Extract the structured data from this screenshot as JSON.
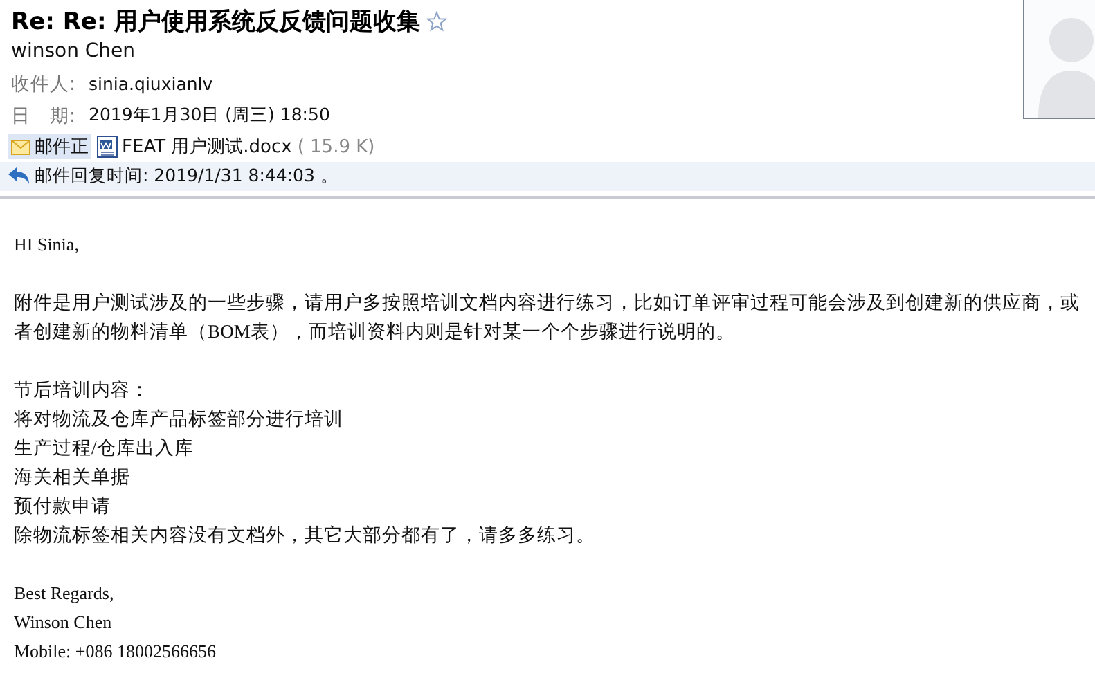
{
  "header": {
    "subject": "Re: Re: 用户使用系统反反馈问题收集",
    "starred": false,
    "sender": "winson Chen",
    "fields": [
      {
        "label": "收件人:",
        "value": "sinia.qiuxianlv"
      },
      {
        "label": "日　期:",
        "value": "2019年1月30日 (周三) 18:50"
      }
    ],
    "tabs": [
      {
        "kind": "body",
        "label": "邮件正",
        "selected": true
      },
      {
        "kind": "attachment",
        "label": "FEAT 用户测试.docx",
        "size": "( 15.9 K)",
        "selected": false
      }
    ],
    "reply_notice": "邮件回复时间: 2019/1/31 8:44:03 。"
  },
  "body": {
    "greeting": "HI Sinia,",
    "paragraph": "附件是用户测试涉及的一些步骤，请用户多按照培训文档内容进行练习，比如订单评审过程可能会涉及到创建新的供应商，或者创建新的物料清单（BOM表），而培训资料内则是针对某一个个步骤进行说明的。",
    "list_title": "节后培训内容：",
    "lines": [
      "将对物流及仓库产品标签部分进行培训",
      "生产过程/仓库出入库",
      "海关相关单据",
      "预付款申请",
      "除物流标签相关内容没有文档外，其它大部分都有了，请多多练习。"
    ],
    "signature": [
      "Best Regards,",
      "Winson Chen",
      "Mobile: +086 18002566656"
    ]
  }
}
